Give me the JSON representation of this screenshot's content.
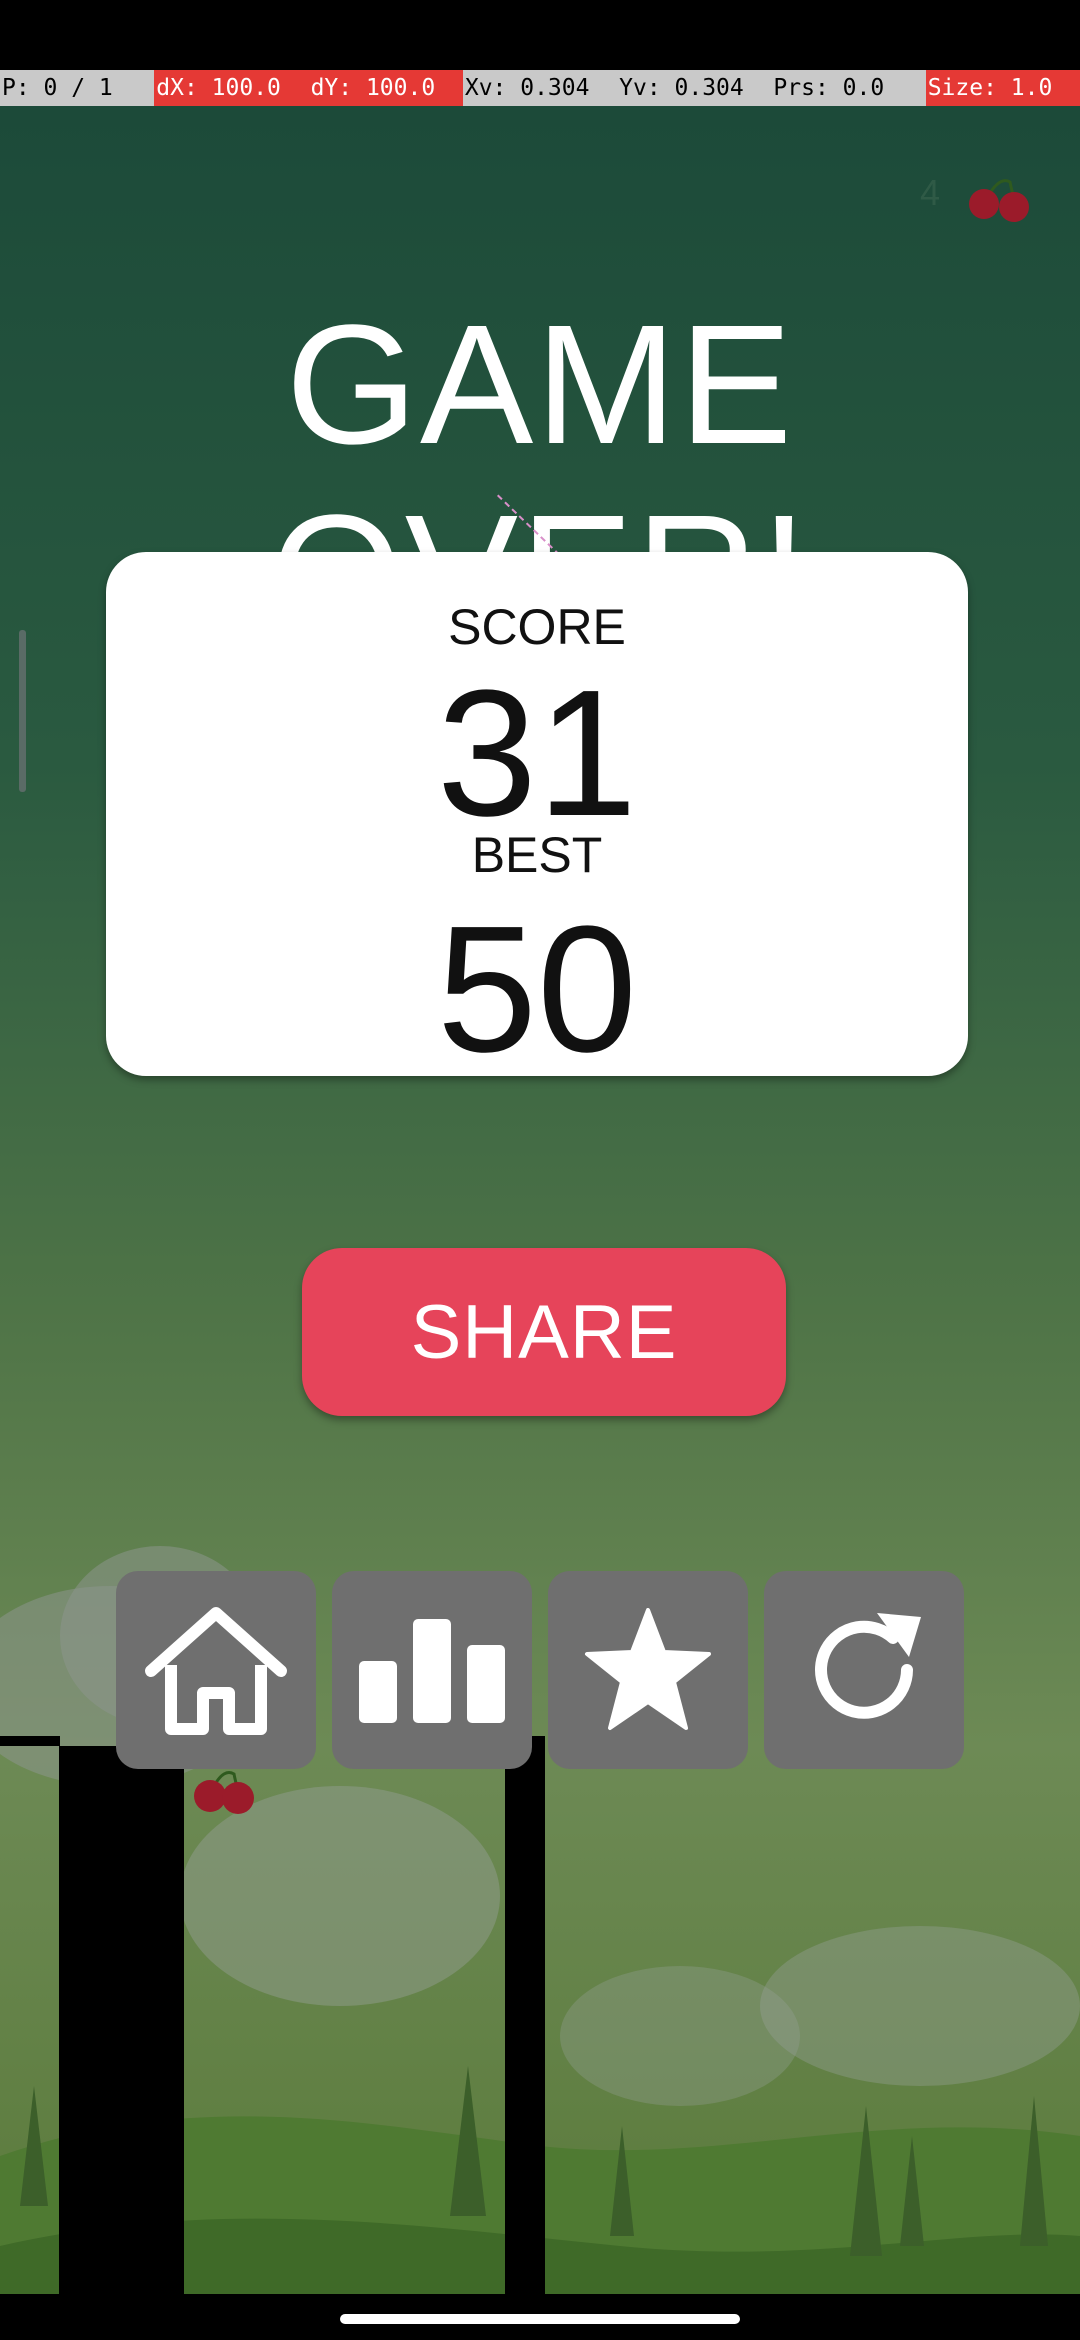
{
  "debug": {
    "pointer": "P: 0 / 1",
    "dx": "dX: 100.0",
    "dy": "dY: 100.0",
    "xv": "Xv: 0.304",
    "yv": "Yv: 0.304",
    "prs": "Prs: 0.0",
    "size": "Size: 1.0"
  },
  "hud": {
    "cherries": "4",
    "cherry_icon": "cherry-icon"
  },
  "title": "GAME OVER!",
  "score_card": {
    "score_label": "SCORE",
    "score_value": "31",
    "best_label": "BEST",
    "best_value": "50"
  },
  "share_label": "SHARE",
  "buttons": [
    {
      "icon": "home-icon"
    },
    {
      "icon": "leaderboard-icon"
    },
    {
      "icon": "star-icon"
    },
    {
      "icon": "restart-icon"
    }
  ],
  "colors": {
    "share": "#e6445a",
    "button_gray": "#6f6f6f",
    "cherry": "#9b1b2a"
  }
}
